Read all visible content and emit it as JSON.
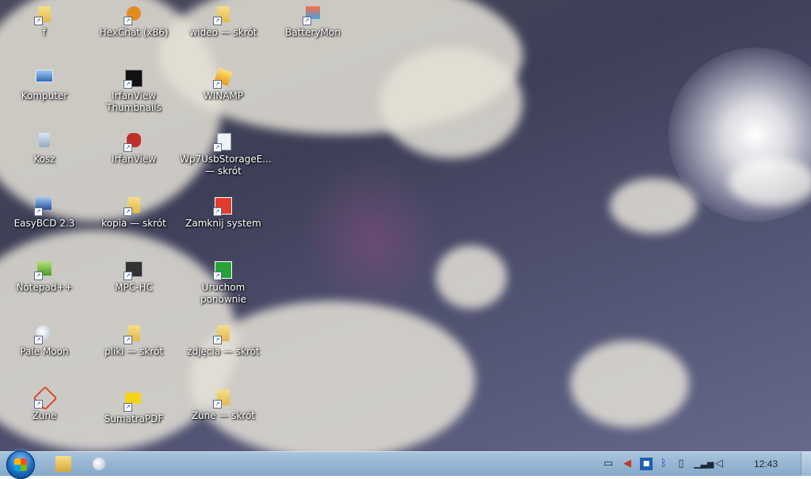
{
  "desktop": {
    "icons": [
      {
        "label": "f",
        "icon": "folder-icon"
      },
      {
        "label": "HexChat (x86)",
        "icon": "hexchat-icon"
      },
      {
        "label": "wideo — skrót",
        "icon": "folder-icon"
      },
      {
        "label": "BatteryMon",
        "icon": "batterymon-icon"
      },
      {
        "label": "Komputer",
        "icon": "computer-icon"
      },
      {
        "label": "IrfanView Thumbnails",
        "icon": "irfanview-thumbnails-icon"
      },
      {
        "label": "WINAMP",
        "icon": "winamp-icon"
      },
      {
        "label": "Kosz",
        "icon": "recycle-bin-icon"
      },
      {
        "label": "IrfanView",
        "icon": "irfanview-icon"
      },
      {
        "label": "Wp7UsbStorageE... — skrót",
        "icon": "usb-storage-icon"
      },
      {
        "label": "EasyBCD 2.3",
        "icon": "easybcd-icon"
      },
      {
        "label": "kopia — skrót",
        "icon": "folder-icon"
      },
      {
        "label": "Zamknij system",
        "icon": "shutdown-icon"
      },
      {
        "label": "Notepad++",
        "icon": "notepad-plus-plus-icon"
      },
      {
        "label": "MPC-HC",
        "icon": "mpc-hc-icon"
      },
      {
        "label": "Uruchom ponownie",
        "icon": "restart-icon"
      },
      {
        "label": "Pale Moon",
        "icon": "pale-moon-icon"
      },
      {
        "label": "pliki — skrót",
        "icon": "folder-icon"
      },
      {
        "label": "zdjęcia — skrót",
        "icon": "folder-icon"
      },
      {
        "label": "Zune",
        "icon": "zune-icon"
      },
      {
        "label": "SumatraPDF",
        "icon": "sumatrapdf-icon"
      },
      {
        "label": "Zune — skrót",
        "icon": "folder-icon"
      }
    ]
  },
  "taskbar": {
    "clock": "12:43",
    "pinned": [
      "windows-explorer-icon",
      "pale-moon-icon"
    ],
    "tray": [
      "network-monitor-icon",
      "volume-icon",
      "app-tray-icon",
      "bluetooth-icon",
      "battery-icon",
      "signal-icon",
      "speaker-icon"
    ]
  }
}
